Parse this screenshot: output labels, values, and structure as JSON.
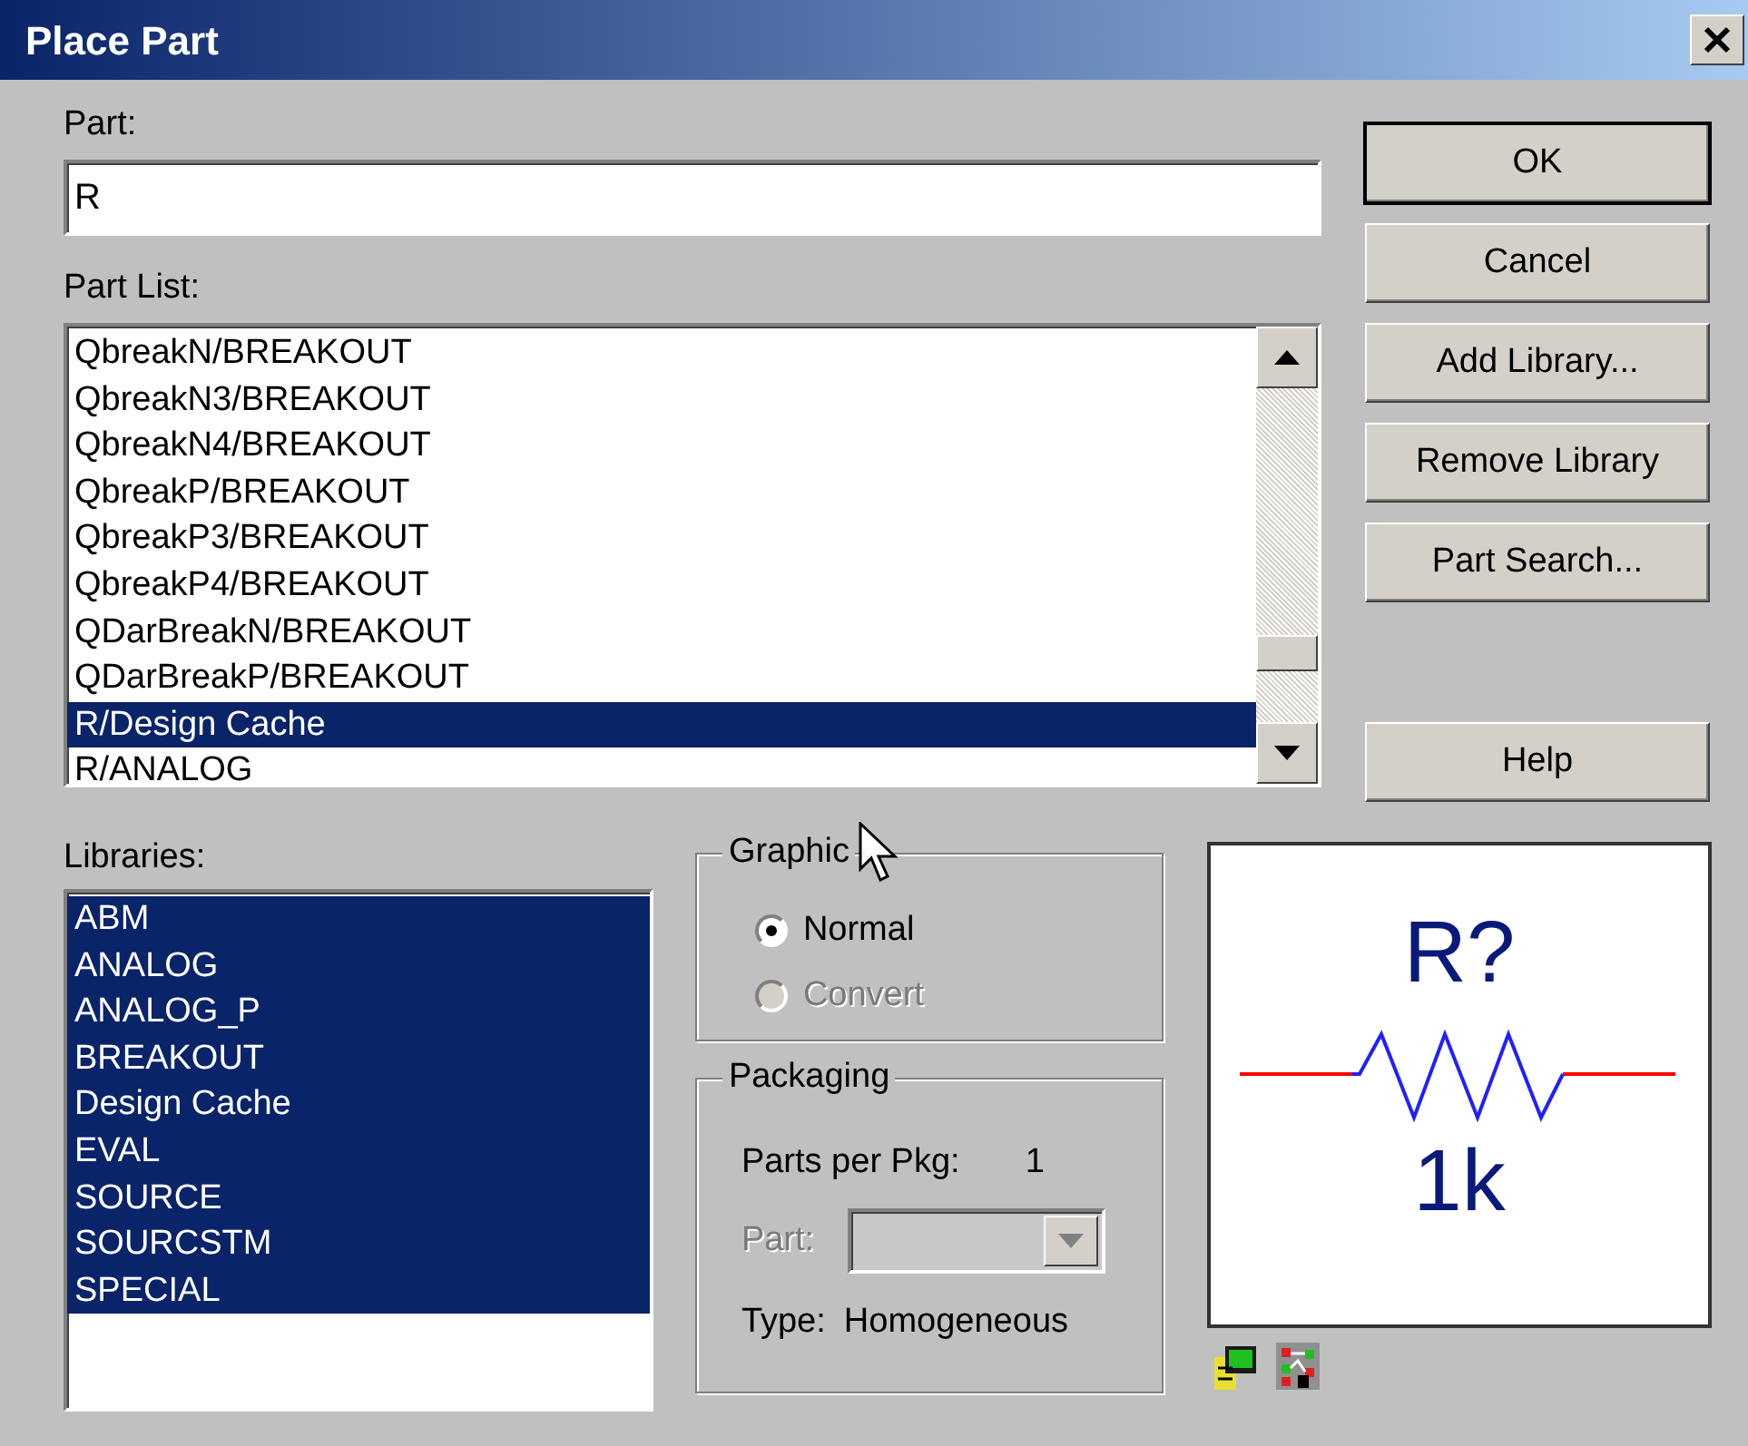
{
  "window": {
    "title": "Place Part"
  },
  "part": {
    "label": "Part:",
    "value": "R"
  },
  "part_list": {
    "label": "Part List:",
    "items": [
      {
        "text": "QbreakN/BREAKOUT",
        "selected": false
      },
      {
        "text": "QbreakN3/BREAKOUT",
        "selected": false
      },
      {
        "text": "QbreakN4/BREAKOUT",
        "selected": false
      },
      {
        "text": "QbreakP/BREAKOUT",
        "selected": false
      },
      {
        "text": "QbreakP3/BREAKOUT",
        "selected": false
      },
      {
        "text": "QbreakP4/BREAKOUT",
        "selected": false
      },
      {
        "text": "QDarBreakN/BREAKOUT",
        "selected": false
      },
      {
        "text": "QDarBreakP/BREAKOUT",
        "selected": false
      },
      {
        "text": "R/Design Cache",
        "selected": true
      },
      {
        "text": "R/ANALOG",
        "selected": false
      }
    ]
  },
  "buttons": [
    {
      "label": "OK",
      "default": true
    },
    {
      "label": "Cancel",
      "default": false
    },
    {
      "label": "Add Library...",
      "default": false
    },
    {
      "label": "Remove Library",
      "default": false
    },
    {
      "label": "Part Search...",
      "default": false
    },
    {
      "label": "Help",
      "default": false
    }
  ],
  "libraries": {
    "label": "Libraries:",
    "items": [
      {
        "text": "ABM",
        "selected": true
      },
      {
        "text": "ANALOG",
        "selected": true
      },
      {
        "text": "ANALOG_P",
        "selected": true
      },
      {
        "text": "BREAKOUT",
        "selected": true
      },
      {
        "text": "Design Cache",
        "selected": true
      },
      {
        "text": "EVAL",
        "selected": true
      },
      {
        "text": "SOURCE",
        "selected": true
      },
      {
        "text": "SOURCSTM",
        "selected": true
      },
      {
        "text": "SPECIAL",
        "selected": true
      }
    ]
  },
  "graphics": {
    "legend": "Graphic",
    "options": [
      {
        "label": "Normal",
        "selected": true,
        "disabled": false
      },
      {
        "label": "Convert",
        "selected": false,
        "disabled": true
      }
    ]
  },
  "packaging": {
    "legend": "Packaging",
    "parts_per_pkg_label": "Parts per Pkg:",
    "parts_per_pkg": "1",
    "part_label": "Part:",
    "part_disabled": true,
    "type_label": "Type:",
    "type": "Homogeneous"
  },
  "preview": {
    "reference": "R?",
    "value": "1k"
  }
}
